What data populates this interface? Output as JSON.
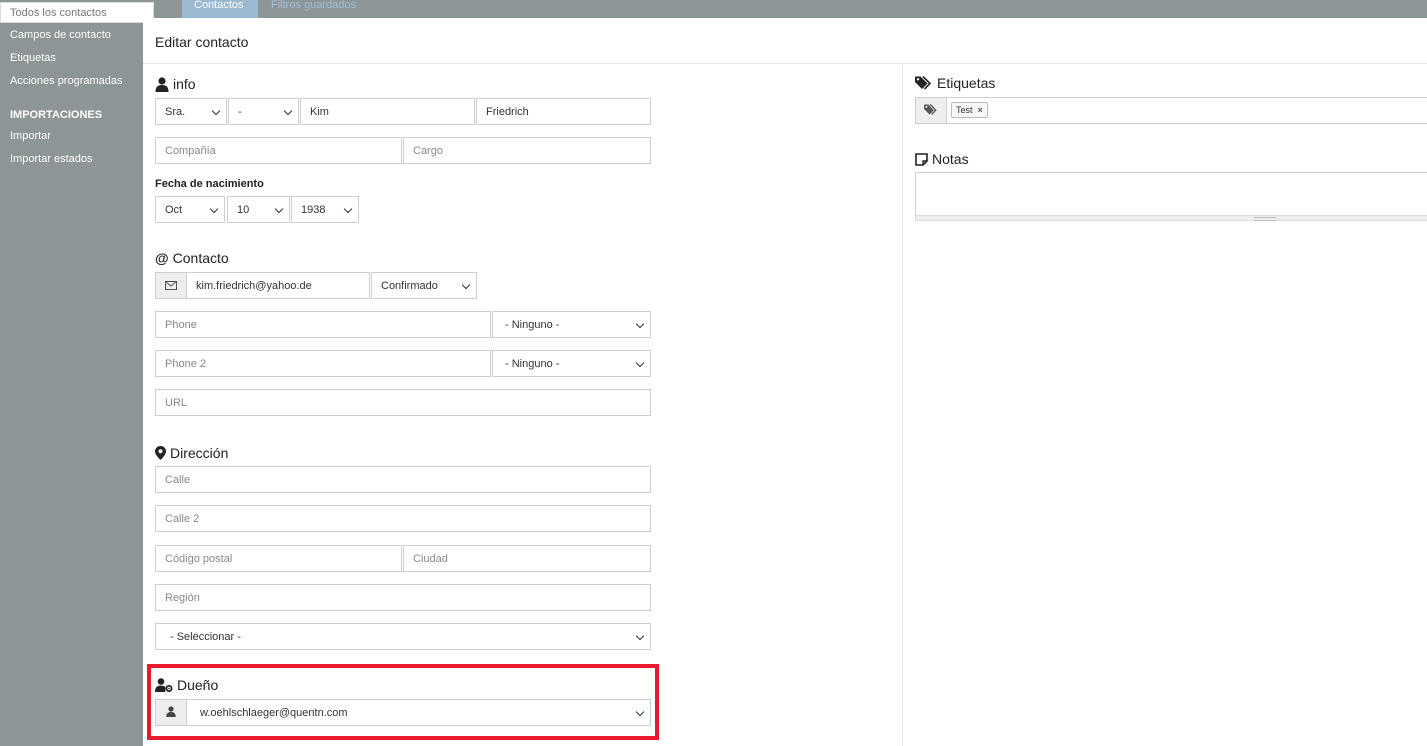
{
  "sidebar": {
    "active_item": "Todos los contactos",
    "items": [
      "Campos de contacto",
      "Etiquetas",
      "Acciones programadas"
    ],
    "imports_heading": "IMPORTACIONES",
    "import_items": [
      "Importar",
      "Importar estados"
    ]
  },
  "tabs": [
    "Contactos",
    "Filtros guardados"
  ],
  "modal": {
    "title": "Editar contacto",
    "info": {
      "heading": "info",
      "salutation": "Sra.",
      "title_select": "-",
      "first_name": "Kim",
      "last_name": "Friedrich",
      "company_placeholder": "Compañía",
      "position_placeholder": "Cargo",
      "birthdate_label": "Fecha de nacimiento",
      "birth_month": "Oct",
      "birth_day": "10",
      "birth_year": "1938"
    },
    "contact": {
      "heading": "Contacto",
      "email": "kim.friedrich@yahoo.de",
      "email_status": "Confirmado",
      "phone_placeholder": "Phone",
      "phone_type": "- Ninguno -",
      "phone2_placeholder": "Phone 2",
      "phone2_type": "- Ninguno -",
      "url_placeholder": "URL"
    },
    "address": {
      "heading": "Dirección",
      "street_placeholder": "Calle",
      "street2_placeholder": "Calle 2",
      "zip_placeholder": "Código postal",
      "city_placeholder": "Ciudad",
      "region_placeholder": "Región",
      "country_select": "- Seleccionar -"
    },
    "owner": {
      "heading": "Dueño",
      "value": "w.oehlschlaeger@quentn.com"
    },
    "tags": {
      "heading": "Etiquetas",
      "items": [
        "Test"
      ]
    },
    "notes": {
      "heading": "Notas"
    }
  },
  "colors": {
    "highlight": "#e8182d",
    "overlay": "#8e9597",
    "tab_active": "#9bb9cf"
  }
}
